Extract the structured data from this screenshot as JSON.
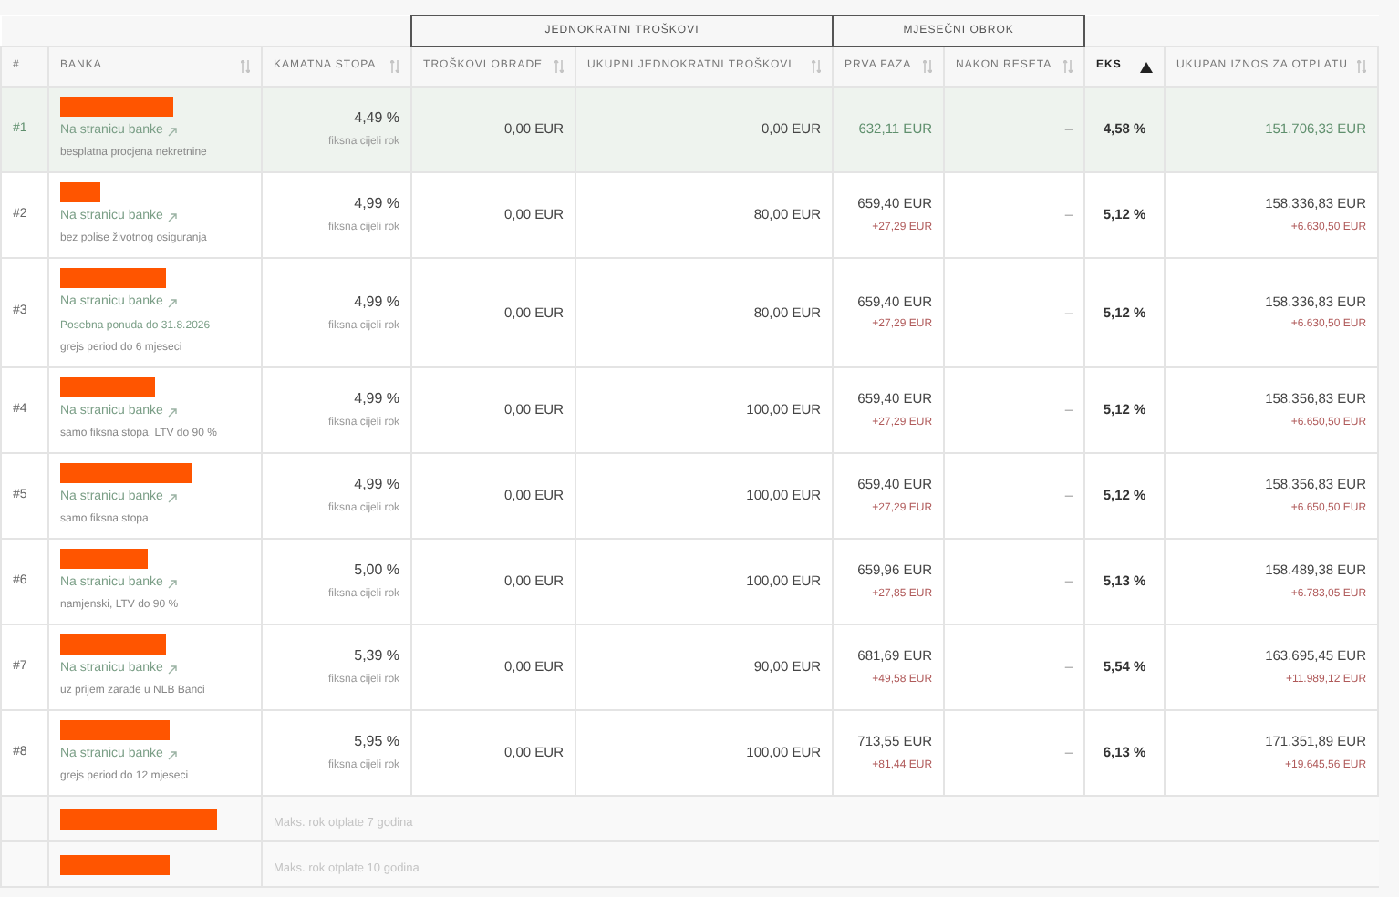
{
  "column_groups": [
    {
      "label": "JEDNOKRATNI TROŠKOVI"
    },
    {
      "label": "MJESEČNI OBROK"
    }
  ],
  "columns": [
    {
      "label": "#",
      "sortable": false,
      "sorted": false
    },
    {
      "label": "BANKA",
      "sortable": true,
      "sorted": false
    },
    {
      "label": "KAMATNA STOPA",
      "sortable": true,
      "sorted": false
    },
    {
      "label": "TROŠKOVI OBRADE",
      "sortable": true,
      "sorted": false
    },
    {
      "label": "UKUPNI JEDNOKRATNI TROŠKOVI",
      "sortable": true,
      "sorted": false
    },
    {
      "label": "PRVA FAZA",
      "sortable": true,
      "sorted": false
    },
    {
      "label": "NAKON RESETA",
      "sortable": true,
      "sorted": false
    },
    {
      "label": "EKS",
      "sorted": true
    },
    {
      "label": "UKUPAN IZNOS ZA OTPLATU",
      "sortable": true,
      "sorted": false
    }
  ],
  "rows": [
    {
      "kind": "offer",
      "selected": true,
      "rank": "#1",
      "link": "Na stranicu banke",
      "notes": [
        {
          "text": "besplatna procjena nekretnine",
          "highlight": false
        }
      ],
      "rate": "4,49 %",
      "rate_note": "fiksna cijeli rok",
      "processing": "0,00 EUR",
      "one_time": "0,00 EUR",
      "first_phase": "632,11 EUR",
      "after_reset": "–",
      "eks": "4,58 %",
      "total": "151.706,33 EUR"
    },
    {
      "kind": "offer",
      "selected": false,
      "rank": "#2",
      "link": "Na stranicu banke",
      "notes": [
        {
          "text": "bez polise životnog osiguranja",
          "highlight": false
        }
      ],
      "rate": "4,99 %",
      "rate_note": "fiksna cijeli rok",
      "processing": "0,00 EUR",
      "one_time": "80,00 EUR",
      "first_phase": "659,40 EUR",
      "first_phase_diff": "+27,29 EUR",
      "after_reset": "–",
      "eks": "5,12 %",
      "total": "158.336,83 EUR",
      "total_diff": "+6.630,50 EUR"
    },
    {
      "kind": "offer",
      "selected": false,
      "rank": "#3",
      "link": "Na stranicu banke",
      "notes": [
        {
          "text": "Posebna ponuda do 31.8.2026",
          "highlight": true
        },
        {
          "text": "grejs period do 6 mjeseci",
          "highlight": false
        }
      ],
      "rate": "4,99 %",
      "rate_note": "fiksna cijeli rok",
      "processing": "0,00 EUR",
      "one_time": "80,00 EUR",
      "first_phase": "659,40 EUR",
      "first_phase_diff": "+27,29 EUR",
      "after_reset": "–",
      "eks": "5,12 %",
      "total": "158.336,83 EUR",
      "total_diff": "+6.630,50 EUR"
    },
    {
      "kind": "offer",
      "selected": false,
      "rank": "#4",
      "link": "Na stranicu banke",
      "notes": [
        {
          "text": "samo fiksna stopa, LTV do 90 %",
          "highlight": false
        }
      ],
      "rate": "4,99 %",
      "rate_note": "fiksna cijeli rok",
      "processing": "0,00 EUR",
      "one_time": "100,00 EUR",
      "first_phase": "659,40 EUR",
      "first_phase_diff": "+27,29 EUR",
      "after_reset": "–",
      "eks": "5,12 %",
      "total": "158.356,83 EUR",
      "total_diff": "+6.650,50 EUR"
    },
    {
      "kind": "offer",
      "selected": false,
      "rank": "#5",
      "link": "Na stranicu banke",
      "notes": [
        {
          "text": "samo fiksna stopa",
          "highlight": false
        }
      ],
      "rate": "4,99 %",
      "rate_note": "fiksna cijeli rok",
      "processing": "0,00 EUR",
      "one_time": "100,00 EUR",
      "first_phase": "659,40 EUR",
      "first_phase_diff": "+27,29 EUR",
      "after_reset": "–",
      "eks": "5,12 %",
      "total": "158.356,83 EUR",
      "total_diff": "+6.650,50 EUR"
    },
    {
      "kind": "offer",
      "selected": false,
      "rank": "#6",
      "link": "Na stranicu banke",
      "notes": [
        {
          "text": "namjenski, LTV do 90 %",
          "highlight": false
        }
      ],
      "rate": "5,00 %",
      "rate_note": "fiksna cijeli rok",
      "processing": "0,00 EUR",
      "one_time": "100,00 EUR",
      "first_phase": "659,96 EUR",
      "first_phase_diff": "+27,85 EUR",
      "after_reset": "–",
      "eks": "5,13 %",
      "total": "158.489,38 EUR",
      "total_diff": "+6.783,05 EUR"
    },
    {
      "kind": "offer",
      "selected": false,
      "rank": "#7",
      "link": "Na stranicu banke",
      "notes": [
        {
          "text": "uz prijem zarade u NLB Banci",
          "highlight": false
        }
      ],
      "rate": "5,39 %",
      "rate_note": "fiksna cijeli rok",
      "processing": "0,00 EUR",
      "one_time": "90,00 EUR",
      "first_phase": "681,69 EUR",
      "first_phase_diff": "+49,58 EUR",
      "after_reset": "–",
      "eks": "5,54 %",
      "total": "163.695,45 EUR",
      "total_diff": "+11.989,12 EUR"
    },
    {
      "kind": "offer",
      "selected": false,
      "rank": "#8",
      "link": "Na stranicu banke",
      "notes": [
        {
          "text": "grejs period do 12 mjeseci",
          "highlight": false
        }
      ],
      "rate": "5,95 %",
      "rate_note": "fiksna cijeli rok",
      "processing": "0,00 EUR",
      "one_time": "100,00 EUR",
      "first_phase": "713,55 EUR",
      "first_phase_diff": "+81,44 EUR",
      "after_reset": "–",
      "eks": "6,13 %",
      "total": "171.351,89 EUR",
      "total_diff": "+19.645,56 EUR"
    },
    {
      "kind": "unavailable",
      "message": "Maks. rok otplate 7 godina"
    },
    {
      "kind": "unavailable",
      "message": "Maks. rok otplate 10 godina"
    }
  ]
}
